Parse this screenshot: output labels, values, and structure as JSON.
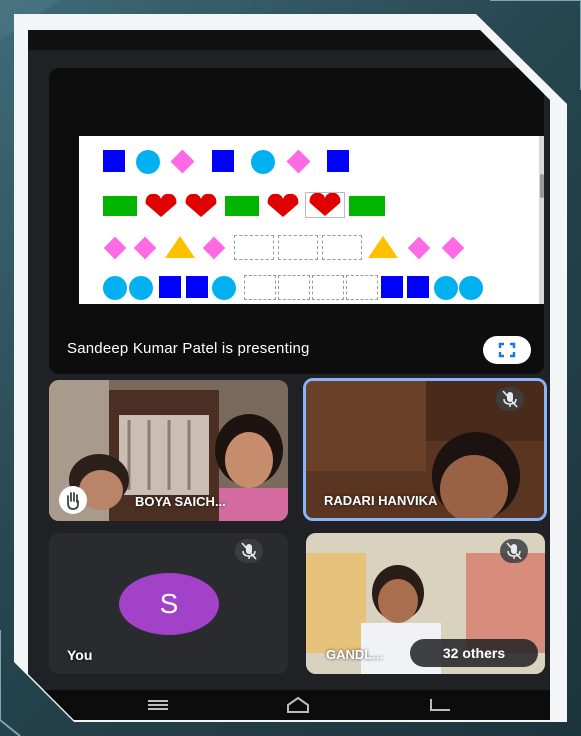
{
  "meeting": {
    "presenter_text": "Sandeep Kumar Patel is presenting"
  },
  "participants": [
    {
      "name": "BOYA SAICH..."
    },
    {
      "name": "RADARI HANVIKA"
    },
    {
      "name": "You",
      "avatar_letter": "S",
      "avatar_color": "#a142c9"
    },
    {
      "name": "GANDL..."
    }
  ],
  "others_chip": {
    "label": "32 others"
  },
  "icons": {
    "fullscreen": "fullscreen-icon",
    "raised_hand": "raised-hand-icon",
    "mic_off": "mic-off-icon",
    "nav_menu": "menu-icon",
    "nav_home": "home-icon",
    "nav_back": "back-icon"
  },
  "colors": {
    "accent_blue": "#8ab4f8",
    "shape_blue": "#0000ff",
    "shape_cyan": "#00b0f0",
    "shape_pink": "#ff69e4",
    "shape_green": "#00b400",
    "shape_red": "#e00000",
    "shape_yellow": "#ffc000"
  }
}
